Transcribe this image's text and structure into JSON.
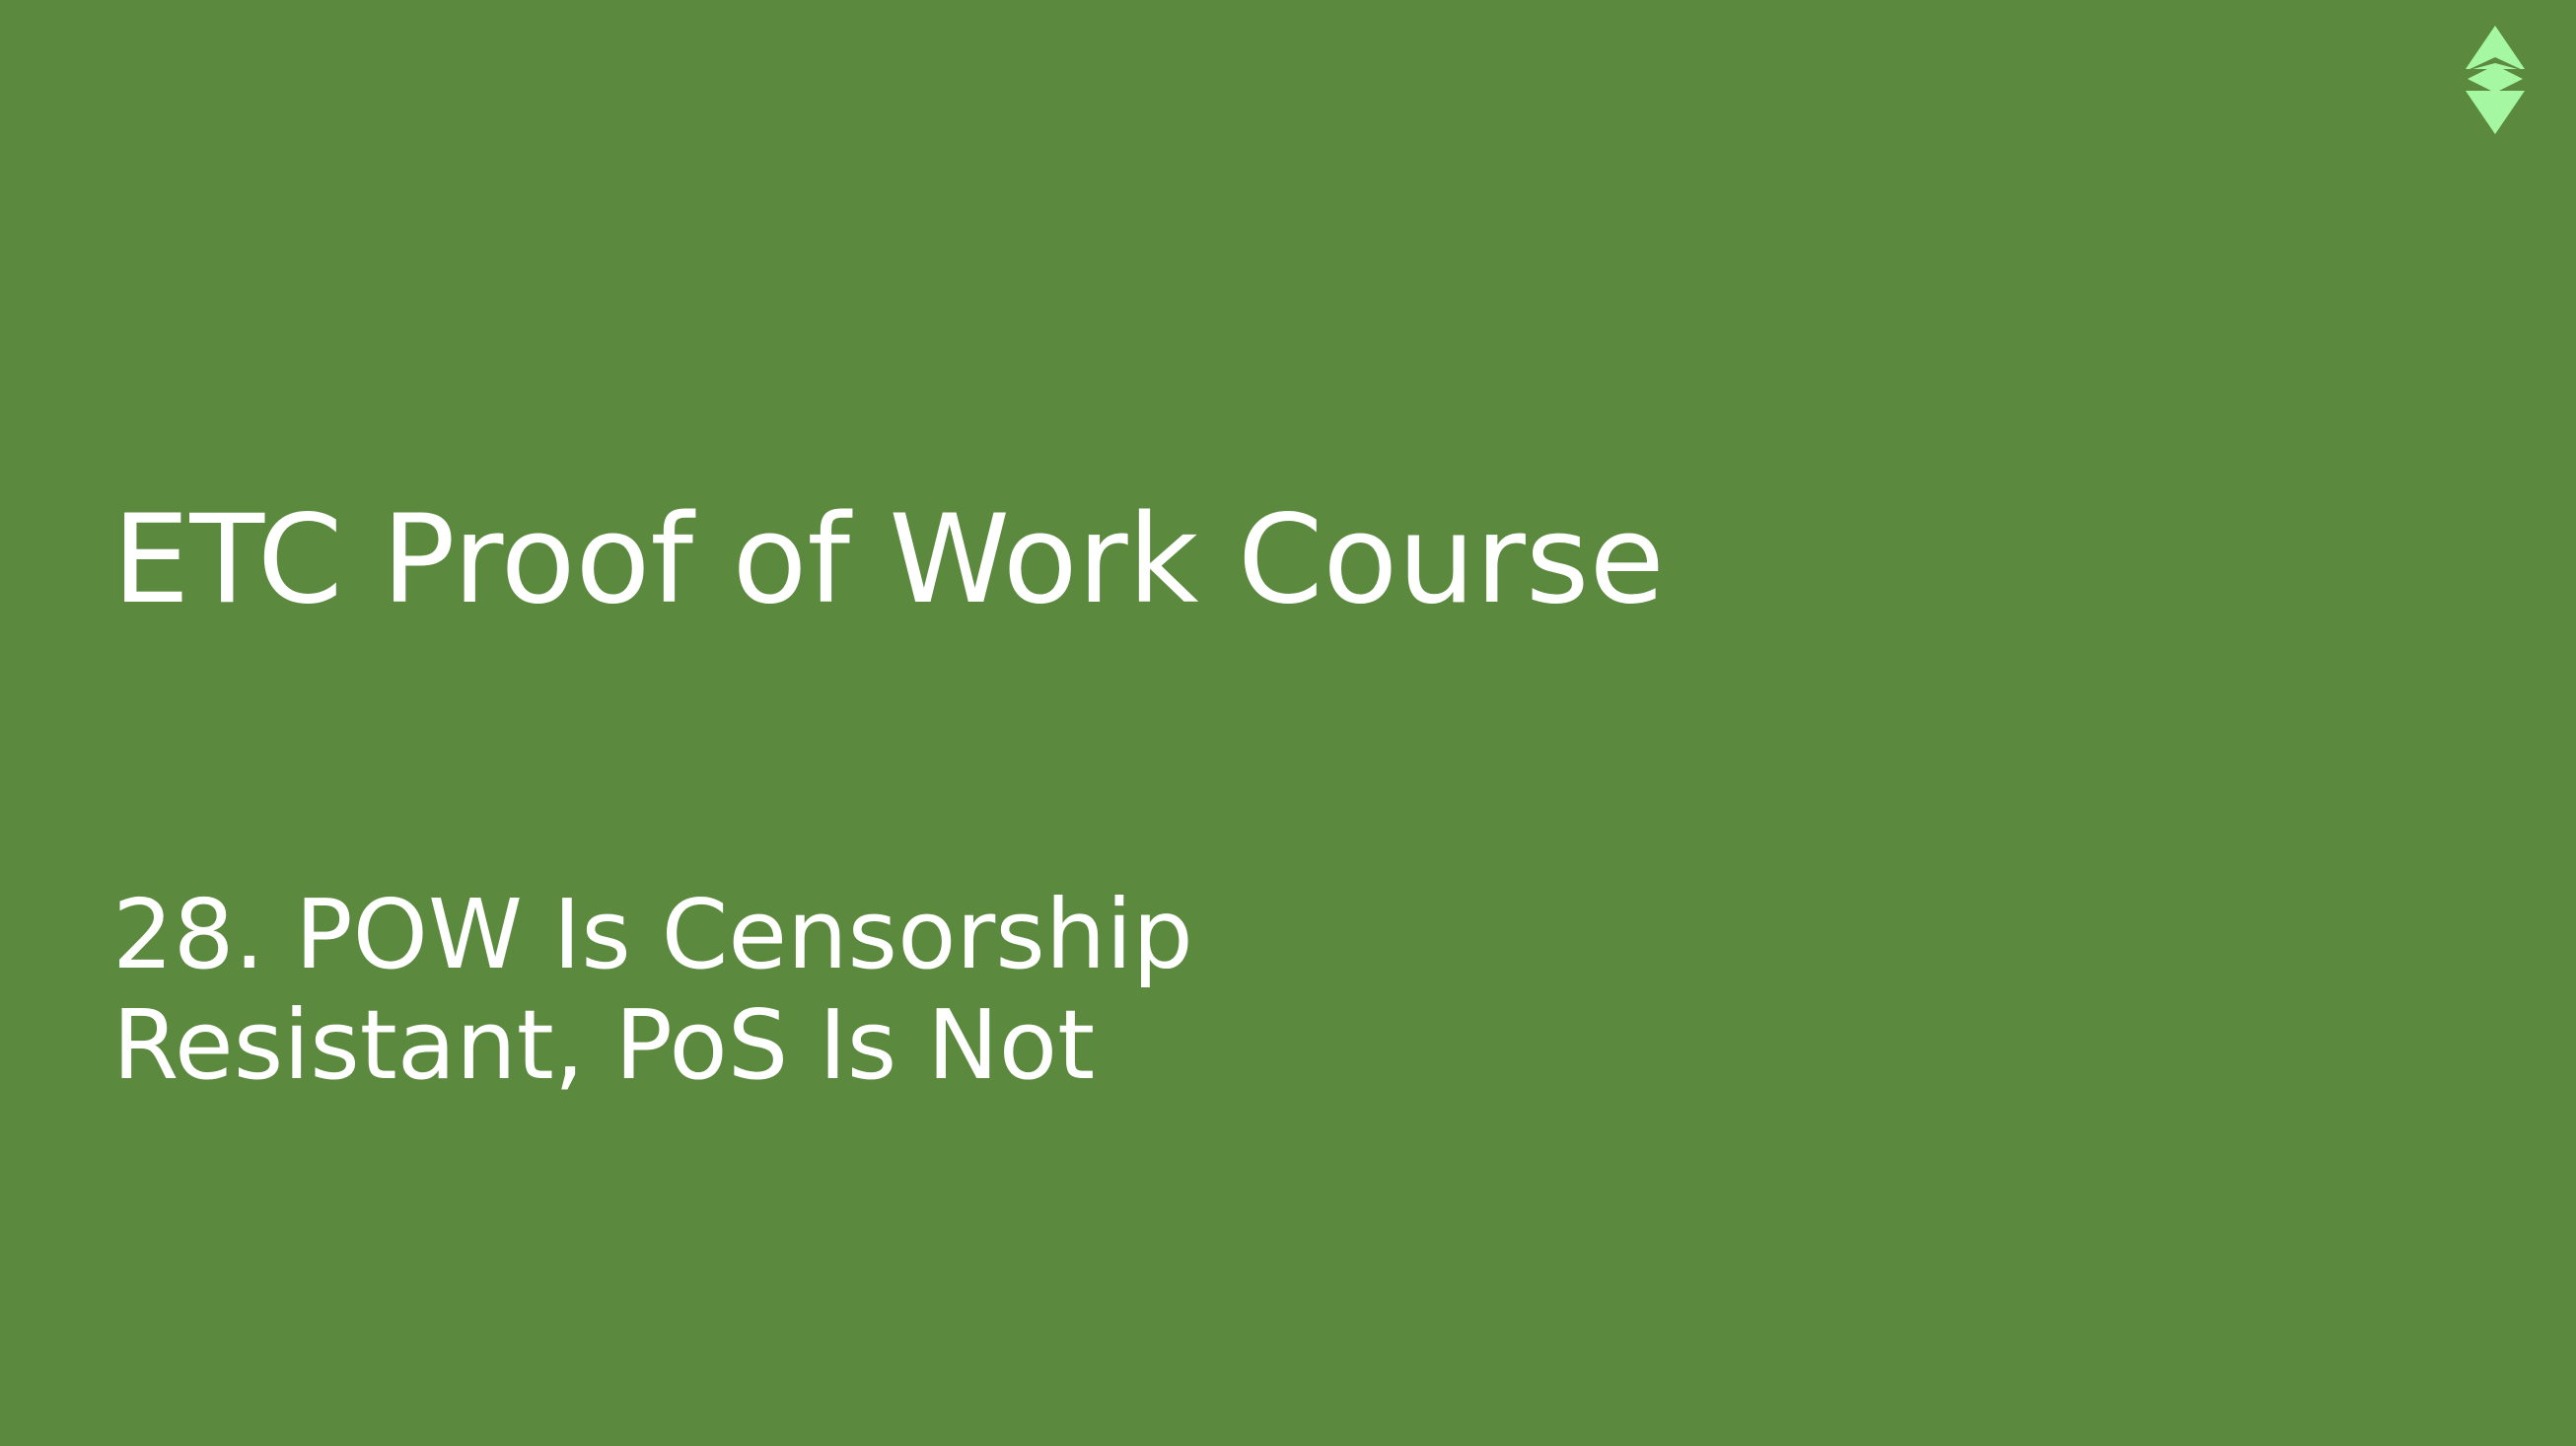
{
  "slide": {
    "title": "ETC Proof of Work Course",
    "subtitle_lines": [
      "28. POW Is Censorship",
      "Resistant, PoS Is Not"
    ]
  },
  "logo": {
    "icon": "ethereum-classic-logo-icon",
    "color": "#a6f7a1"
  },
  "colors": {
    "background": "#5b8a3f",
    "text": "#ffffff"
  }
}
